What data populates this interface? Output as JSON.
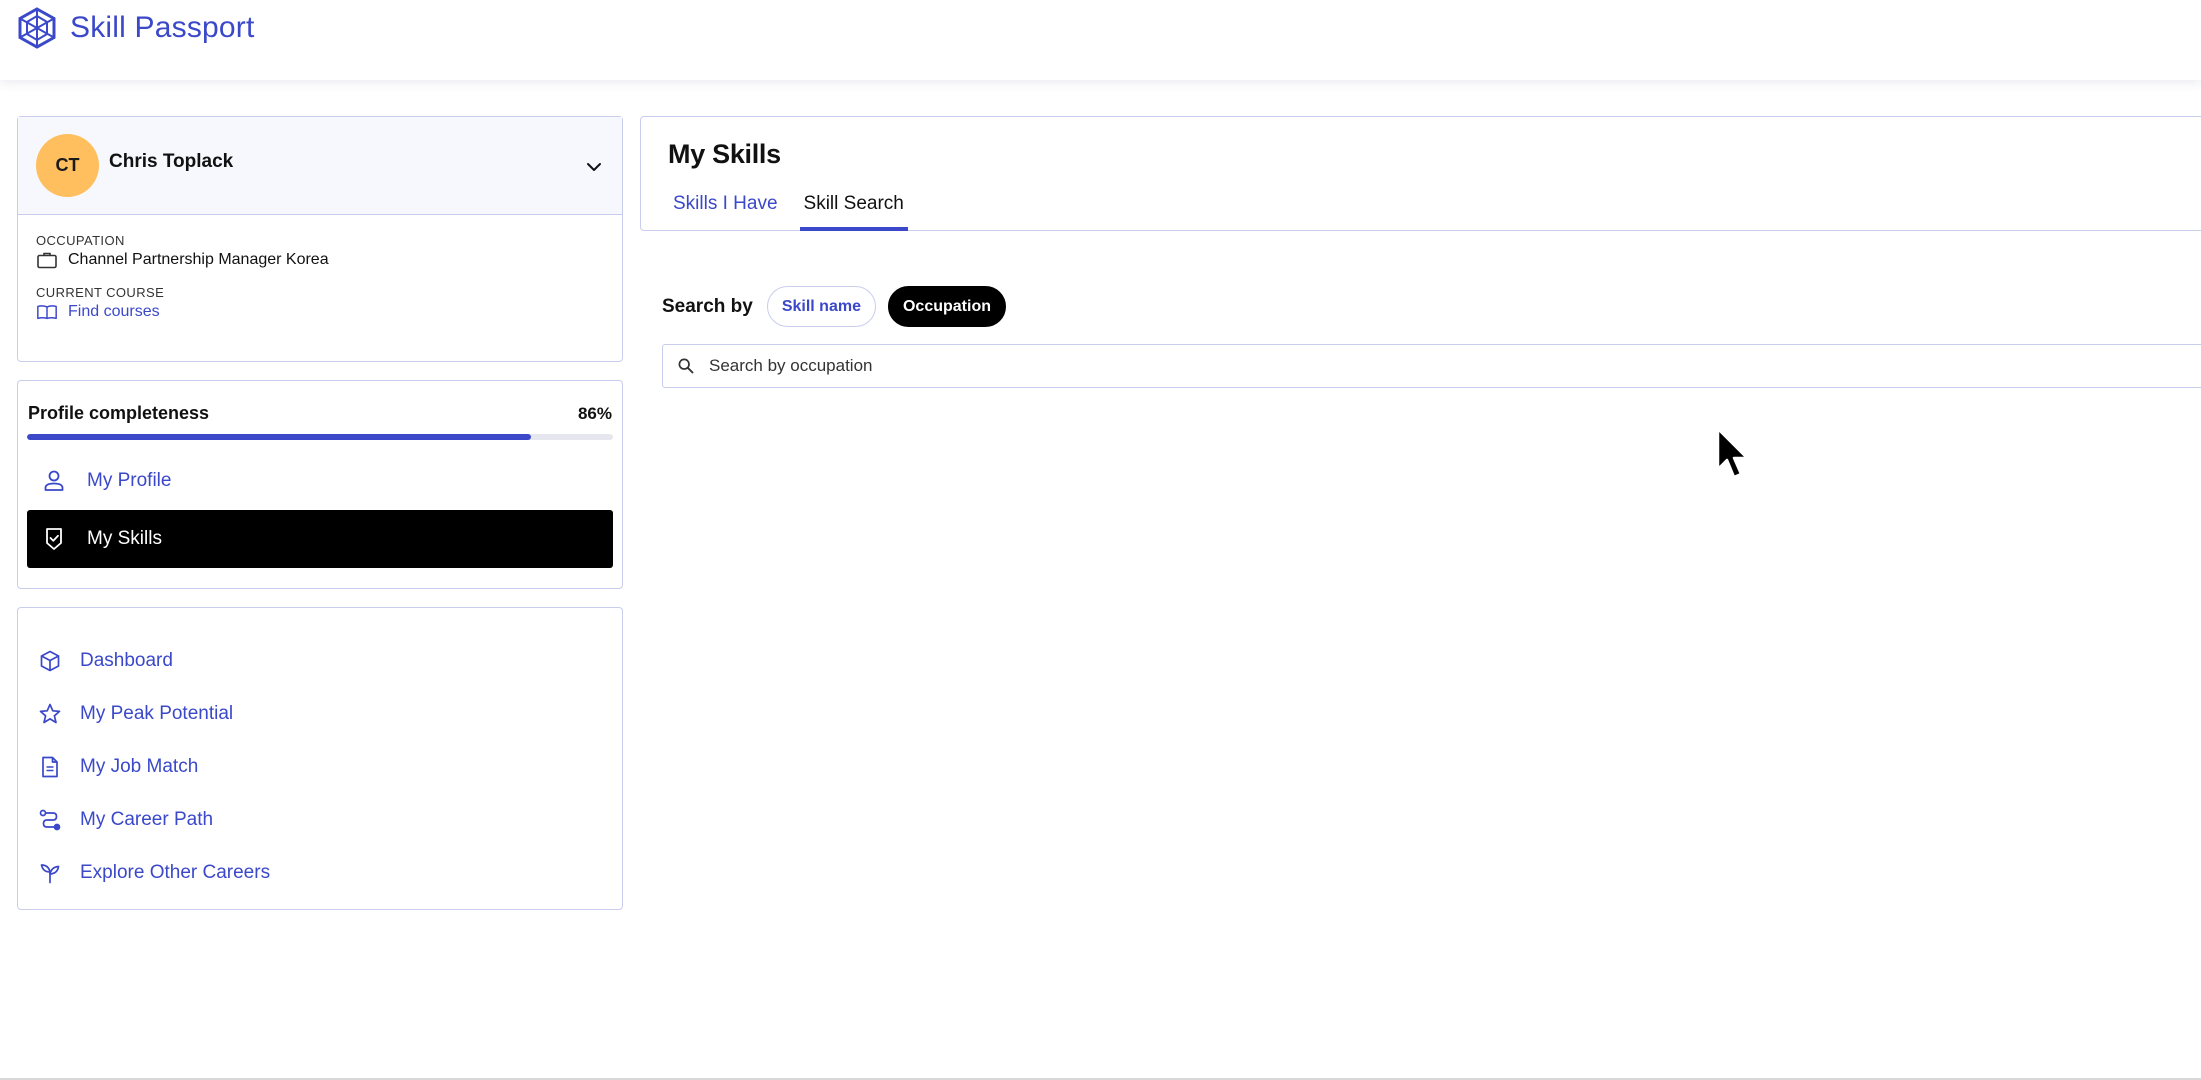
{
  "brand": {
    "name": "Skill Passport",
    "logo_icon": "hexagon-globe-icon",
    "color": "#3a48c9"
  },
  "profile": {
    "initials": "CT",
    "name": "Chris Toplack",
    "avatar_color": "#ffbf5e",
    "occupation_label": "OCCUPATION",
    "occupation_value": "Channel Partnership Manager Korea",
    "course_label": "CURRENT COURSE",
    "course_link": "Find courses"
  },
  "completeness": {
    "title": "Profile completeness",
    "percent_label": "86%",
    "percent": 86
  },
  "profile_nav": [
    {
      "label": "My Profile",
      "icon": "person-icon",
      "active": false
    },
    {
      "label": "My Skills",
      "icon": "shield-check-icon",
      "active": true
    }
  ],
  "main_nav": [
    {
      "label": "Dashboard",
      "icon": "cube-icon"
    },
    {
      "label": "My Peak Potential",
      "icon": "star-icon"
    },
    {
      "label": "My Job Match",
      "icon": "document-icon"
    },
    {
      "label": "My Career Path",
      "icon": "route-icon"
    },
    {
      "label": "Explore Other Careers",
      "icon": "sprout-icon"
    }
  ],
  "main": {
    "title": "My Skills",
    "tabs": [
      {
        "label": "Skills I Have",
        "active": false
      },
      {
        "label": "Skill Search",
        "active": true
      }
    ],
    "search_by_label": "Search by",
    "search_options": [
      {
        "label": "Skill name",
        "selected": false
      },
      {
        "label": "Occupation",
        "selected": true
      }
    ],
    "search_placeholder": "Search by occupation",
    "search_value": ""
  }
}
